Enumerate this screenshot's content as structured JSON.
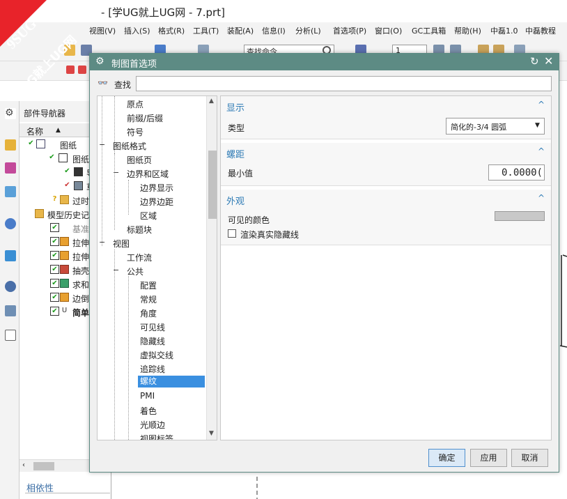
{
  "app": {
    "title": "[学UG就上UG网 - 7.prt]",
    "title_prefix": "-",
    "menus": [
      "视图(V)",
      "插入(S)",
      "格式(R)",
      "工具(T)",
      "装配(A)",
      "信息(I)",
      "分析(L)",
      "首选项(P)",
      "窗口(O)",
      "GC工具箱",
      "帮助(H)",
      "中磊1.0",
      "中磊教程"
    ],
    "command_search_placeholder": "查找命令",
    "layer_value": "1"
  },
  "watermark": {
    "line1": "9SUG",
    "line2": "学UG就上UG网",
    "color": "#e8232a"
  },
  "part_navigator": {
    "title": "部件导航器",
    "column_name": "名称",
    "rows": [
      {
        "label": "图纸"
      },
      {
        "label": "图纸"
      },
      {
        "label": "导"
      },
      {
        "label": "草"
      },
      {
        "label": "过时"
      },
      {
        "label": "模型历史记"
      },
      {
        "label": "基准"
      },
      {
        "label": "拉伸"
      },
      {
        "label": "拉伸"
      },
      {
        "label": "抽壳"
      },
      {
        "label": "求和"
      },
      {
        "label": "边倒"
      },
      {
        "label": "简单"
      }
    ],
    "dependencies_label": "相依性"
  },
  "dialog": {
    "title": "制图首选项",
    "find_label": "查找",
    "find_value": "",
    "tree": [
      {
        "label": "原点",
        "level": 2
      },
      {
        "label": "前缀/后缀",
        "level": 2
      },
      {
        "label": "符号",
        "level": 2
      },
      {
        "label": "图纸格式",
        "level": 1,
        "toggle": "−"
      },
      {
        "label": "图纸页",
        "level": 2
      },
      {
        "label": "边界和区域",
        "level": 2,
        "toggle": "−"
      },
      {
        "label": "边界显示",
        "level": 3
      },
      {
        "label": "边界边距",
        "level": 3
      },
      {
        "label": "区域",
        "level": 3
      },
      {
        "label": "标题块",
        "level": 2
      },
      {
        "label": "视图",
        "level": 1,
        "toggle": "−"
      },
      {
        "label": "工作流",
        "level": 2
      },
      {
        "label": "公共",
        "level": 2,
        "toggle": "−"
      },
      {
        "label": "配置",
        "level": 3
      },
      {
        "label": "常规",
        "level": 3
      },
      {
        "label": "角度",
        "level": 3
      },
      {
        "label": "可见线",
        "level": 3
      },
      {
        "label": "隐藏线",
        "level": 3
      },
      {
        "label": "虚拟交线",
        "level": 3
      },
      {
        "label": "追踪线",
        "level": 3
      },
      {
        "label": "螺纹",
        "level": 3,
        "selected": true
      },
      {
        "label": "PMI",
        "level": 3
      },
      {
        "label": "着色",
        "level": 3
      },
      {
        "label": "光顺边",
        "level": 3
      },
      {
        "label": "视图标签",
        "level": 3
      }
    ],
    "sections": {
      "display": {
        "title": "显示",
        "type_label": "类型",
        "type_value": "简化的-3/4 圆弧"
      },
      "pitch": {
        "title": "螺距",
        "min_label": "最小值",
        "min_value": "0.0000("
      },
      "appearance": {
        "title": "外观",
        "visible_color_label": "可见的颜色",
        "visible_color": "#c8c8c8",
        "render_hidden_label": "渲染真实隐藏线",
        "render_hidden_checked": false
      }
    },
    "buttons": {
      "ok": "确定",
      "apply": "应用",
      "cancel": "取消"
    },
    "accent_color": "#5d8b84",
    "selected_color": "#3a8fe0"
  }
}
